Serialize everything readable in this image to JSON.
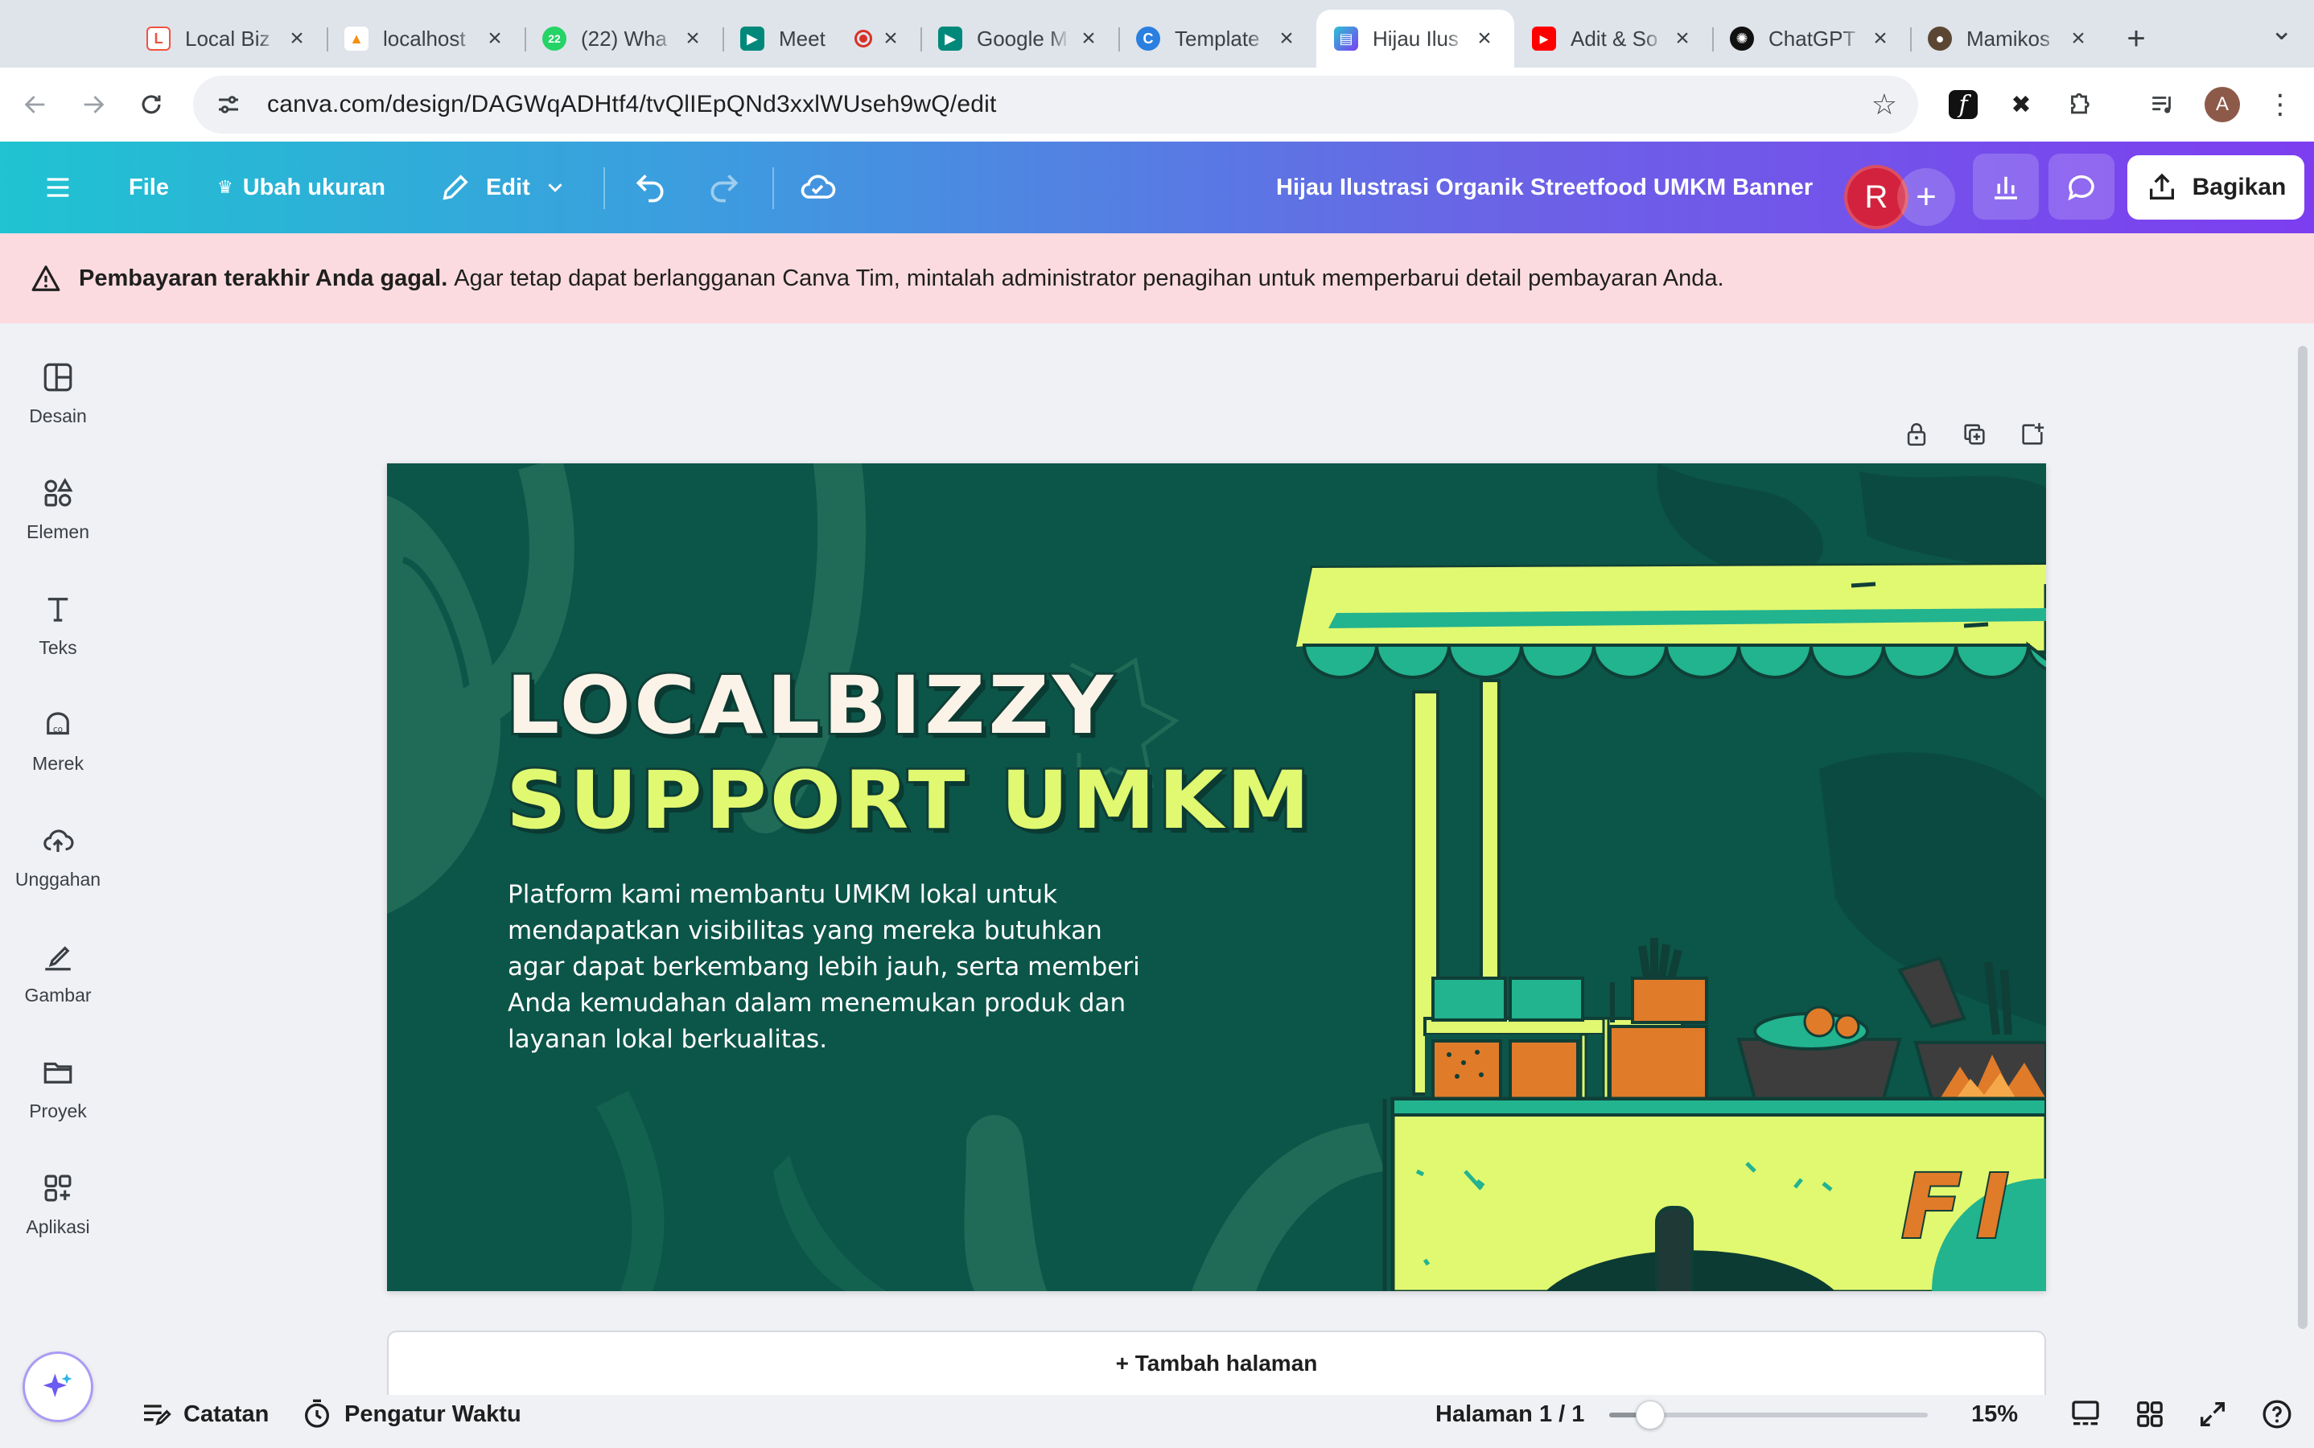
{
  "browser": {
    "tabs": [
      {
        "title": "Local Biz",
        "icon": "laravel-icon",
        "color": "#f05340"
      },
      {
        "title": "localhost",
        "icon": "phpmyadmin-icon",
        "color": "#f29111"
      },
      {
        "title": "(22) Wha",
        "icon": "whatsapp-icon",
        "color": "#25d366",
        "badge": "22"
      },
      {
        "title": "Meet",
        "icon": "google-meet-icon",
        "color": "#00897b",
        "recording": true
      },
      {
        "title": "Google M",
        "icon": "google-meet-icon",
        "color": "#00897b"
      },
      {
        "title": "Template",
        "icon": "canva-icon",
        "color": "#2a7fe0"
      },
      {
        "title": "Hijau Ilus",
        "icon": "canva-doc-icon",
        "color": "#7b3ff2",
        "active": true
      },
      {
        "title": "Adit & So",
        "icon": "youtube-icon",
        "color": "#ff0000"
      },
      {
        "title": "ChatGPT",
        "icon": "chatgpt-icon",
        "color": "#111111"
      },
      {
        "title": "Mamikos",
        "icon": "mamikos-icon",
        "color": "#5a4632"
      }
    ],
    "new_tab": "+",
    "url": "canva.com/design/DAGWqADHtf4/tvQlIEpQNd3xxlWUseh9wQ/edit",
    "profile_initial": "A"
  },
  "header": {
    "file": "File",
    "resize": "Ubah ukuran",
    "edit": "Edit",
    "title": "Hijau Ilustrasi Organik Streetfood UMKM Banner",
    "collaborator_initial": "R",
    "share": "Bagikan"
  },
  "banner": {
    "bold": "Pembayaran terakhir Anda gagal.",
    "text": "Agar tetap dapat berlangganan Canva Tim, mintalah administrator penagihan untuk memperbarui detail pembayaran Anda."
  },
  "sidebar": {
    "items": [
      {
        "label": "Desain",
        "icon": "layout-icon"
      },
      {
        "label": "Elemen",
        "icon": "shapes-icon"
      },
      {
        "label": "Teks",
        "icon": "text-icon"
      },
      {
        "label": "Merek",
        "icon": "brand-icon"
      },
      {
        "label": "Unggahan",
        "icon": "cloud-upload-icon"
      },
      {
        "label": "Gambar",
        "icon": "draw-icon"
      },
      {
        "label": "Proyek",
        "icon": "folder-icon"
      },
      {
        "label": "Aplikasi",
        "icon": "apps-icon"
      }
    ]
  },
  "design": {
    "headline_line1": "LOCALBIZZY",
    "headline_line2": "SUPPORT UMKM",
    "description": "Platform kami membantu UMKM lokal untuk mendapatkan visibilitas yang mereka butuhkan agar dapat berkembang lebih jauh, serta memberi Anda kemudahan dalam menemukan produk dan layanan lokal berkualitas.",
    "cart_text": "FI",
    "colors": {
      "background": "#0c5549",
      "lime": "#e1f871",
      "teal": "#22b38f",
      "orange": "#e07b2a"
    }
  },
  "canvas": {
    "add_page": "+ Tambah halaman"
  },
  "bottom": {
    "notes": "Catatan",
    "timer": "Pengatur Waktu",
    "page_indicator": "Halaman 1 / 1",
    "zoom": "15%",
    "zoom_fraction": 0.13
  }
}
